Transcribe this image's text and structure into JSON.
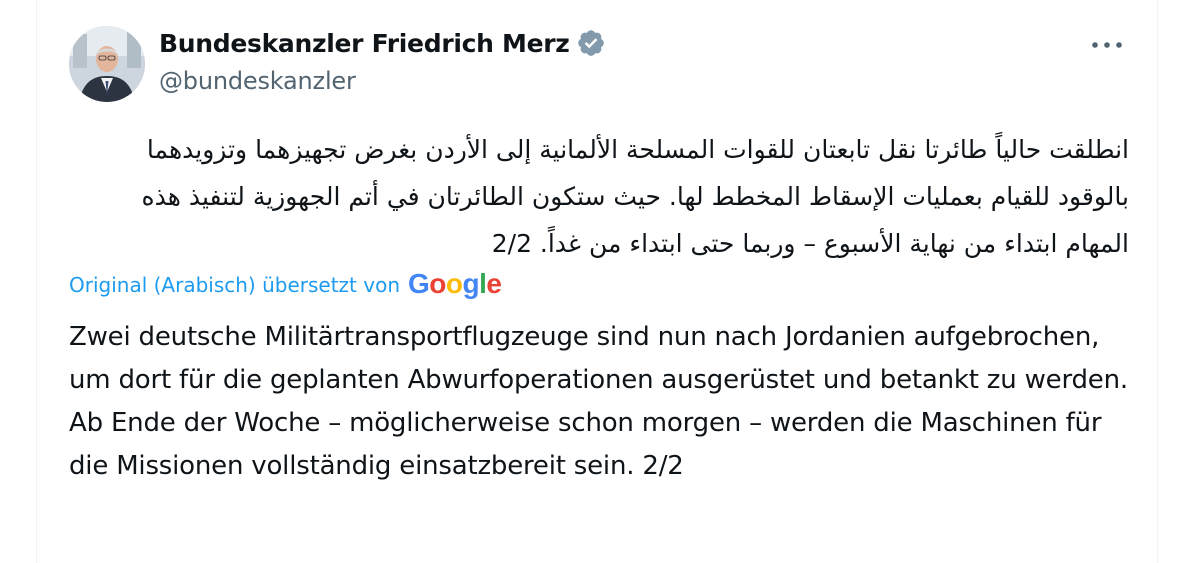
{
  "tweet": {
    "display_name": "Bundeskanzler Friedrich Merz",
    "handle": "@bundeskanzler",
    "avatar_icon": "profile-photo",
    "verified_icon": "verified-badge-icon",
    "more_icon": "more-horizontal-icon",
    "original_text": "انطلقت حالياً طائرتا نقل تابعتان للقوات المسلحة الألمانية إلى الأردن بغرض تجهيزهما وتزويدهما بالوقود للقيام بعمليات الإسقاط المخطط لها. حيث ستكون الطائرتان في أتم الجهوزية لتنفيذ هذه المهام ابتداء من نهاية الأسبوع – وربما حتى ابتداء من غداً. 2/2",
    "translation_note": "Original (Arabisch) übersetzt von",
    "translation_provider": "Google",
    "translated_text": "Zwei deutsche Militärtransportflugzeuge sind nun nach Jordanien aufgebrochen, um dort für die geplanten Abwurfoperationen ausgerüstet und betankt zu werden. Ab Ende der Woche – möglicherweise schon morgen – werden die Maschinen für die Missionen vollständig einsatzbereit sein. 2/2"
  },
  "colors": {
    "text": "#0f1419",
    "secondary": "#536471",
    "link": "#1d9bf0",
    "verified": "#829aab",
    "google_blue": "#4285f4",
    "google_red": "#ea4335",
    "google_yellow": "#fbbc05",
    "google_green": "#34a853"
  }
}
